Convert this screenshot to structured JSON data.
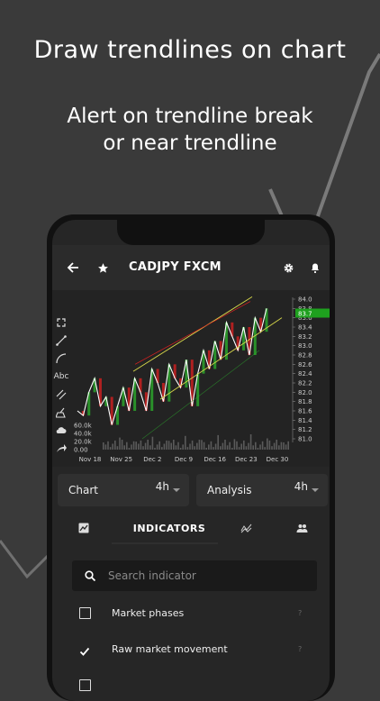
{
  "headline": {
    "line1": "Draw trendlines on chart",
    "line2a": "Alert on trendline break",
    "line2b": "or near trendline"
  },
  "appbar": {
    "title": "CADJPY FXCM"
  },
  "toolbar": {
    "text_tool": "Abc"
  },
  "chart": {
    "price_ticks": [
      "84.0",
      "83.8",
      "83.6",
      "83.4",
      "83.2",
      "83.0",
      "82.8",
      "82.6",
      "82.4",
      "82.2",
      "82.0",
      "81.8",
      "81.6",
      "81.4",
      "81.2",
      "81.0"
    ],
    "current_price": "83.7",
    "volume_ticks": [
      "60.0k",
      "40.0k",
      "20.0k",
      "0.00"
    ],
    "date_ticks": [
      "Nov 18",
      "Nov 25",
      "Dec 2",
      "Dec 9",
      "Dec 16",
      "Dec 23",
      "Dec 30"
    ],
    "colors": {
      "up": "#2db52d",
      "down": "#e02020",
      "trendline": "#d8d84a",
      "line": "#ffffff",
      "price_tag": "#1ea01e"
    }
  },
  "chart_data": {
    "type": "line",
    "x": [
      "Nov 18",
      "Nov 25",
      "Dec 2",
      "Dec 9",
      "Dec 16",
      "Dec 23",
      "Dec 30"
    ],
    "ylim": [
      81.0,
      84.0
    ],
    "y_ticks": [
      84.0,
      83.8,
      83.6,
      83.4,
      83.2,
      83.0,
      82.8,
      82.6,
      82.4,
      82.2,
      82.0,
      81.8,
      81.6,
      81.4,
      81.2,
      81.0
    ],
    "current": 83.7,
    "volume_ticks": [
      "60.0k",
      "40.0k",
      "20.0k",
      "0.00"
    ]
  },
  "selects": {
    "chart": {
      "label": "Chart",
      "value": "4h"
    },
    "analysis": {
      "label": "Analysis",
      "value": "4h"
    }
  },
  "tabs": {
    "indicators": "INDICATORS"
  },
  "search": {
    "placeholder": "Search indicator"
  },
  "indicators": [
    {
      "label": "Market phases",
      "checked": false,
      "help": "?"
    },
    {
      "label": "Raw market movement",
      "checked": true,
      "help": "?"
    }
  ]
}
